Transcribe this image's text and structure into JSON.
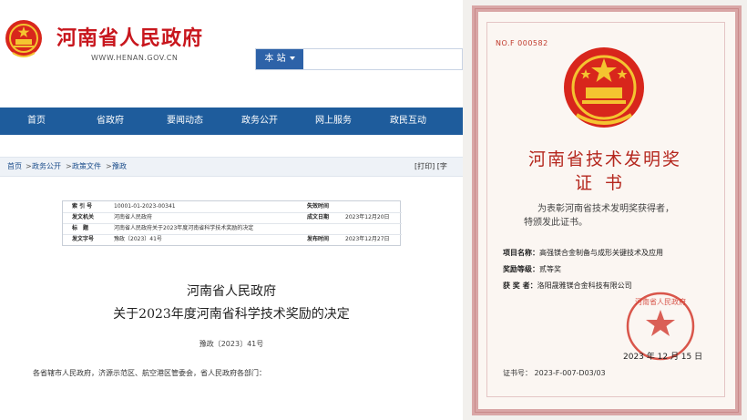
{
  "site": {
    "title": "河南省人民政府",
    "url": "WWW.HENAN.GOV.CN",
    "search_scope": "本 站",
    "search_placeholder": ""
  },
  "nav": {
    "items": [
      "首页",
      "省政府",
      "要闻动态",
      "政务公开",
      "网上服务",
      "政民互动"
    ]
  },
  "breadcrumb": {
    "items": [
      "首页",
      "政务公开",
      "政策文件",
      "豫政"
    ],
    "separator": ">",
    "tools": "[打印]  [字"
  },
  "meta": {
    "index_label": "索 引 号",
    "index_value": "10001-01-2023-00341",
    "validity_label": "失效时间",
    "validity_value": "",
    "issuer_label": "发文机关",
    "issuer_value": "河南省人民政府",
    "created_label": "成文日期",
    "created_value": "2023年12月20日",
    "title_label": "标　题",
    "title_value": "河南省人民政府关于2023年度河南省科学技术奖励的决定",
    "docno_label": "发文字号",
    "docno_value": "豫政〔2023〕41号",
    "published_label": "发布时间",
    "published_value": "2023年12月27日"
  },
  "document": {
    "title_line1": "河南省人民政府",
    "title_line2": "关于2023年度河南省科学技术奖励的决定",
    "doc_number": "豫政〔2023〕41号",
    "salutation": "各省辖市人民政府，济源示范区、航空港区管委会，省人民政府各部门："
  },
  "certificate": {
    "number": "NO.F 000582",
    "title": "河南省技术发明奖",
    "subtitle": "证书",
    "text_line1": "为表彰河南省技术发明奖获得者，",
    "text_line2": "特颁发此证书。",
    "project_label": "项目名称：",
    "project_value": "高强镁合金制备与成形关键技术及应用",
    "grade_label": "奖励等级：",
    "grade_value": "贰等奖",
    "winner_label": "获 奖 者：",
    "winner_value": "洛阳晟雅镁合金科技有限公司",
    "date": "2023 年 12 月 15 日",
    "cert_id": "证书号： 2023-F-007-D03/03",
    "seal_text": "河南省人民政府"
  },
  "colors": {
    "brand_red": "#c8161d",
    "nav_blue": "#1e5c9c",
    "cert_red": "#b5271e",
    "gold": "#f4c430"
  }
}
